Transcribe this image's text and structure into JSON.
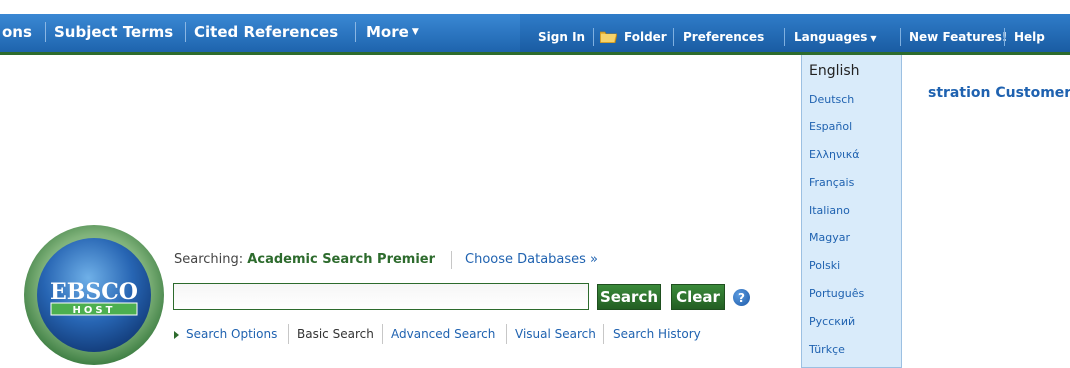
{
  "nav": {
    "items": [
      {
        "label": "ons"
      },
      {
        "label": "Subject Terms"
      },
      {
        "label": "Cited References"
      },
      {
        "label": "More"
      }
    ],
    "right": [
      {
        "label": "Sign In"
      },
      {
        "label": "Folder"
      },
      {
        "label": "Preferences"
      },
      {
        "label": "Languages"
      },
      {
        "label": "New Features!"
      },
      {
        "label": "Help"
      }
    ]
  },
  "languages": {
    "current": "English",
    "options": [
      "Deutsch",
      "Español",
      "Ελληνικά",
      "Français",
      "Italiano",
      "Magyar",
      "Polski",
      "Português",
      "Русский",
      "Türkçe"
    ]
  },
  "customer_text": "stration Customer",
  "logo": {
    "top": "EBSCO",
    "bottom": "HOST"
  },
  "search": {
    "searching_label": "Searching:",
    "database": "Academic Search Premier",
    "choose_databases": "Choose Databases »",
    "input_value": "",
    "search_button": "Search",
    "clear_button": "Clear",
    "help_symbol": "?"
  },
  "subnav": {
    "search_options": "Search Options",
    "basic_search": "Basic Search",
    "advanced_search": "Advanced Search",
    "visual_search": "Visual Search",
    "search_history": "Search History"
  },
  "colors": {
    "nav_blue": "#1e64ad",
    "accent_green": "#2d6b2d",
    "link_blue": "#1f62b0",
    "menu_bg": "#d9ebfa"
  },
  "icons": [
    "folder-icon",
    "dropdown-arrow-icon",
    "help-icon",
    "ebsco-host-logo",
    "expand-triangle-icon"
  ]
}
